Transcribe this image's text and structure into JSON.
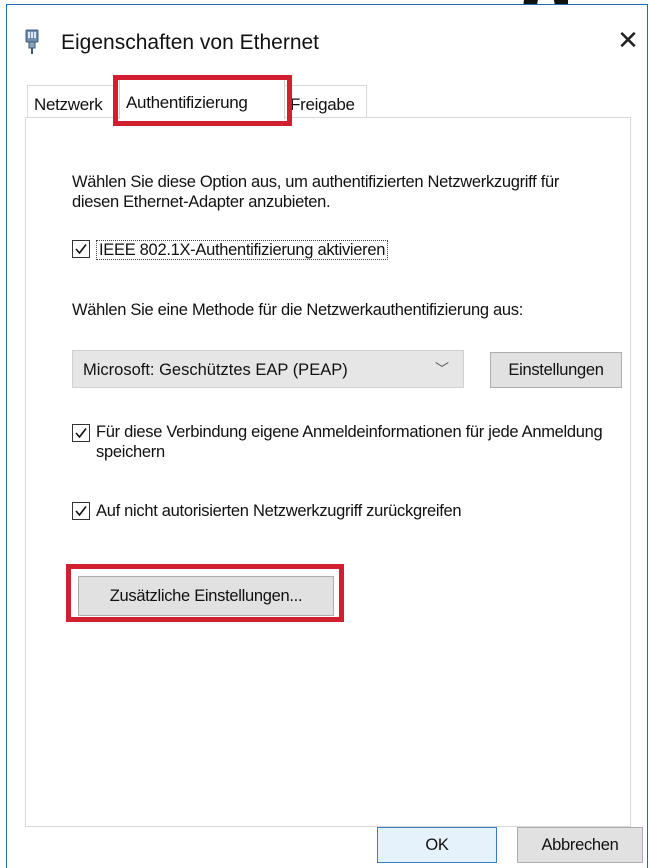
{
  "window": {
    "title": "Eigenschaften von Ethernet",
    "close_glyph": "✕",
    "title_icon": "network-adapter-icon"
  },
  "tabs": [
    {
      "label": "Netzwerk"
    },
    {
      "label": "Authentifizierung"
    },
    {
      "label": "Freigabe"
    }
  ],
  "active_tab": "Authentifizierung",
  "panel": {
    "description": "Wählen Sie diese Option aus, um authentifizierten Netzwerkzugriff für diesen Ethernet-Adapter anzubieten.",
    "enable_8021x": {
      "label": "IEEE 802.1X-Authentifizierung aktivieren",
      "checked": true
    },
    "method_prompt": "Wählen Sie eine Methode für die Netzwerkauthentifizierung aus:",
    "method_select": {
      "selected": "Microsoft: Geschütztes EAP (PEAP)"
    },
    "settings_button": "Einstellungen",
    "remember_credentials": {
      "label": "Für diese Verbindung eigene Anmeldeinformationen für jede Anmeldung speichern",
      "checked": true
    },
    "fallback": {
      "label": "Auf nicht autorisierten Netzwerkzugriff zurückgreifen",
      "checked": true
    },
    "additional_button": "Zusätzliche Einstellungen..."
  },
  "footer": {
    "ok_label": "OK",
    "cancel_label": "Abbrechen"
  },
  "colors": {
    "highlight": "#d21f2f",
    "window_border": "#1f6ab8",
    "ok_border": "#3a7bd5"
  }
}
